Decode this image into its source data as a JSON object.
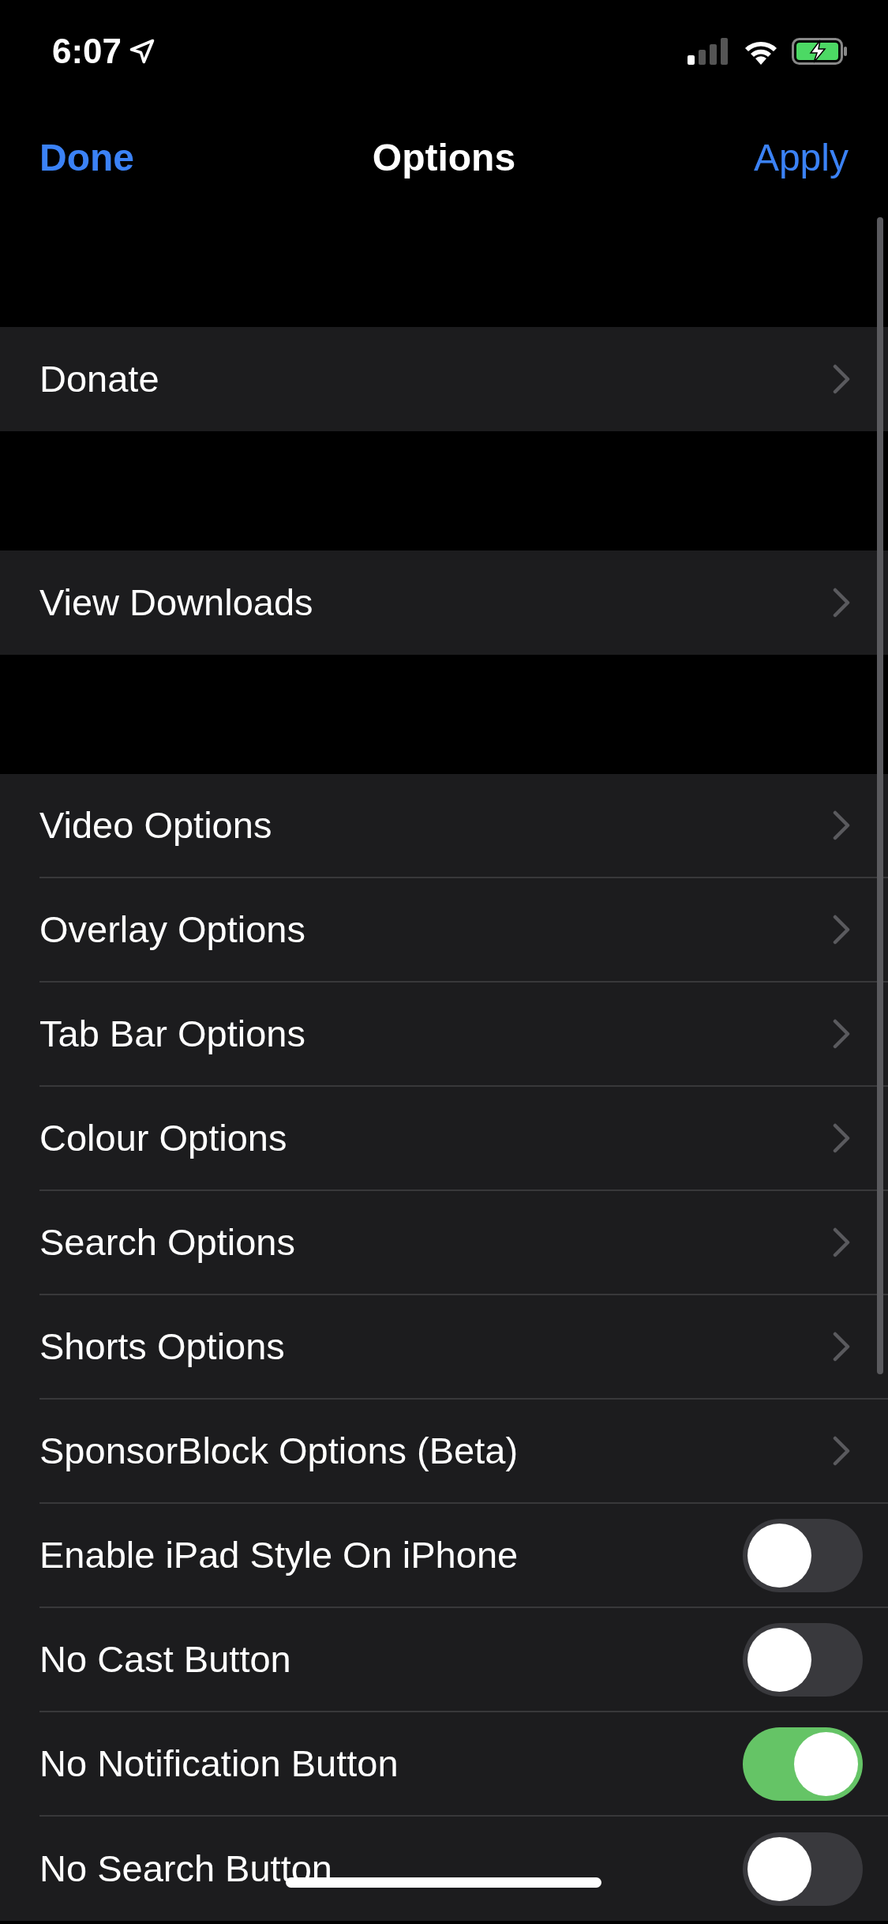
{
  "status_bar": {
    "time": "6:07"
  },
  "nav": {
    "left_button": "Done",
    "title": "Options",
    "right_button": "Apply"
  },
  "sections": [
    {
      "rows": [
        {
          "label": "Donate",
          "kind": "link"
        }
      ]
    },
    {
      "rows": [
        {
          "label": "View Downloads",
          "kind": "link"
        }
      ]
    },
    {
      "rows": [
        {
          "label": "Video Options",
          "kind": "link"
        },
        {
          "label": "Overlay Options",
          "kind": "link"
        },
        {
          "label": "Tab Bar Options",
          "kind": "link"
        },
        {
          "label": "Colour Options",
          "kind": "link"
        },
        {
          "label": "Search Options",
          "kind": "link"
        },
        {
          "label": "Shorts Options",
          "kind": "link"
        },
        {
          "label": "SponsorBlock Options (Beta)",
          "kind": "link"
        },
        {
          "label": "Enable iPad Style On iPhone",
          "kind": "toggle",
          "on": false
        },
        {
          "label": "No Cast Button",
          "kind": "toggle",
          "on": false
        },
        {
          "label": "No Notification Button",
          "kind": "toggle",
          "on": true
        },
        {
          "label": "No Search Button",
          "kind": "toggle",
          "on": false
        }
      ]
    }
  ]
}
